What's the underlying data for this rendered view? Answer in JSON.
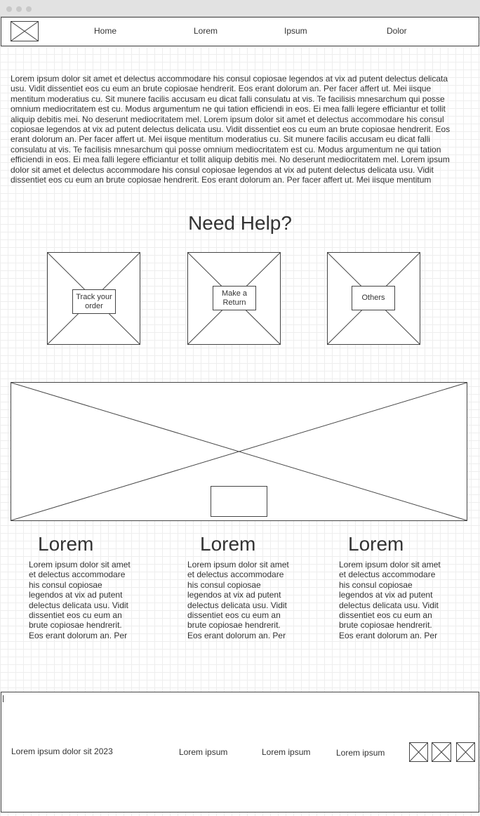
{
  "window": {
    "controls": [
      "close",
      "minimize",
      "maximize"
    ]
  },
  "nav": {
    "logo_icon": "image-placeholder-icon",
    "items": [
      "Home",
      "Lorem",
      "Ipsum",
      "Dolor"
    ]
  },
  "intro": {
    "text": "Lorem ipsum dolor sit amet et delectus accommodare his consul copiosae legendos at vix ad putent delectus delicata usu. Vidit dissentiet eos cu eum an brute copiosae hendrerit. Eos erant dolorum an. Per facer affert ut. Mei iisque mentitum moderatius cu. Sit munere facilis accusam eu dicat falli consulatu at vis. Te facilisis mnesarchum qui posse omnium mediocritatem est cu. Modus argumentum ne qui tation efficiendi in eos. Ei mea falli legere efficiantur et tollit aliquip debitis mei. No deserunt mediocritatem mel. Lorem ipsum dolor sit amet et delectus accommodare his consul copiosae legendos at vix ad putent delectus delicata usu. Vidit dissentiet eos cu eum an brute copiosae hendrerit. Eos erant dolorum an. Per facer affert ut. Mei iisque mentitum moderatius cu. Sit munere facilis accusam eu dicat falli consulatu at vis. Te facilisis mnesarchum qui posse omnium mediocritatem est cu. Modus argumentum ne qui tation efficiendi in eos. Ei mea falli legere efficiantur et tollit aliquip debitis mei. No deserunt mediocritatem mel. Lorem ipsum dolor sit amet et delectus accommodare his consul copiosae legendos at vix ad putent delectus delicata usu. Vidit dissentiet eos cu eum an brute copiosae hendrerit. Eos erant dolorum an. Per facer affert ut. Mei iisque mentitum"
  },
  "help": {
    "title": "Need Help?",
    "cards": [
      {
        "label": "Track your order",
        "icon": "image-placeholder-icon"
      },
      {
        "label": "Make a Return",
        "icon": "image-placeholder-icon"
      },
      {
        "label": "Others",
        "icon": "image-placeholder-icon"
      }
    ]
  },
  "banner": {
    "icon": "image-placeholder-icon",
    "button_label": ""
  },
  "columns": [
    {
      "title": "Lorem",
      "text": "Lorem ipsum dolor sit amet et delectus accommodare his consul copiosae legendos at vix ad putent delectus delicata usu. Vidit dissentiet eos cu eum an brute copiosae hendrerit. Eos erant dolorum an. Per"
    },
    {
      "title": "Lorem",
      "text": "Lorem ipsum dolor sit amet et delectus accommodare his consul copiosae legendos at vix ad putent delectus delicata usu. Vidit dissentiet eos cu eum an brute copiosae hendrerit. Eos erant dolorum an. Per"
    },
    {
      "title": "Lorem",
      "text": "Lorem ipsum dolor sit amet et delectus accommodare his consul copiosae legendos at vix ad putent delectus delicata usu. Vidit dissentiet eos cu eum an brute copiosae hendrerit. Eos erant dolorum an. Per"
    }
  ],
  "footer": {
    "copyright": "Lorem ipsum dolor sit 2023",
    "links": [
      "Lorem ipsum",
      "Lorem ipsum",
      "Lorem ipsum"
    ],
    "social_icons": [
      "image-placeholder-icon",
      "image-placeholder-icon",
      "image-placeholder-icon"
    ]
  }
}
